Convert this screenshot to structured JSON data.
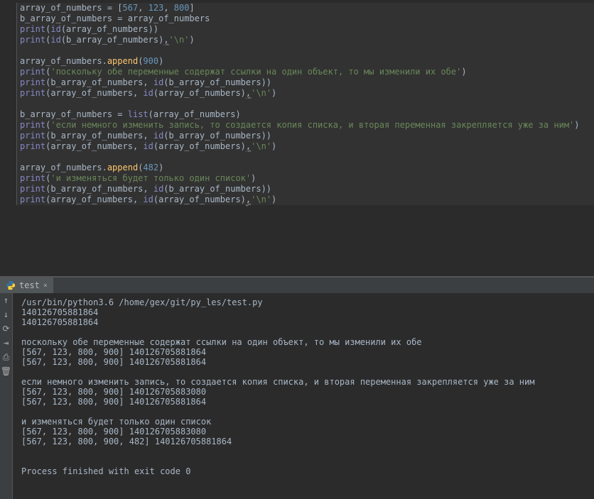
{
  "editor": {
    "lines": [
      {
        "tokens": [
          {
            "t": "array_of_numbers ",
            "c": "k-var"
          },
          {
            "t": "=",
            "c": "punc"
          },
          {
            "t": " [",
            "c": "punc"
          },
          {
            "t": "567",
            "c": "k-num"
          },
          {
            "t": ", ",
            "c": "punc"
          },
          {
            "t": "123",
            "c": "k-num"
          },
          {
            "t": ", ",
            "c": "punc"
          },
          {
            "t": "800",
            "c": "k-num"
          },
          {
            "t": "]",
            "c": "punc"
          }
        ]
      },
      {
        "tokens": [
          {
            "t": "b_array_of_numbers ",
            "c": "k-var"
          },
          {
            "t": "=",
            "c": "punc"
          },
          {
            "t": " array_of_numbers",
            "c": "k-var"
          }
        ]
      },
      {
        "tokens": [
          {
            "t": "print",
            "c": "k-builtin"
          },
          {
            "t": "(",
            "c": "punc"
          },
          {
            "t": "id",
            "c": "k-builtin"
          },
          {
            "t": "(array_of_numbers))",
            "c": "k-var"
          }
        ]
      },
      {
        "tokens": [
          {
            "t": "print",
            "c": "k-builtin"
          },
          {
            "t": "(",
            "c": "punc"
          },
          {
            "t": "id",
            "c": "k-builtin"
          },
          {
            "t": "(b_array_of_numbers)",
            "c": "k-var"
          },
          {
            "t": ",",
            "c": "comma-mark"
          },
          {
            "t": "'\\n'",
            "c": "k-str"
          },
          {
            "t": ")",
            "c": "punc"
          }
        ]
      },
      {
        "tokens": []
      },
      {
        "tokens": [
          {
            "t": "array_of_numbers.",
            "c": "k-var"
          },
          {
            "t": "append",
            "c": "k-func"
          },
          {
            "t": "(",
            "c": "punc"
          },
          {
            "t": "900",
            "c": "k-num"
          },
          {
            "t": ")",
            "c": "punc"
          }
        ]
      },
      {
        "tokens": [
          {
            "t": "print",
            "c": "k-builtin"
          },
          {
            "t": "(",
            "c": "punc"
          },
          {
            "t": "'поскольку обе переменные содержат ссылки на один объект, то мы изменили их обе'",
            "c": "k-str"
          },
          {
            "t": ")",
            "c": "punc"
          }
        ]
      },
      {
        "tokens": [
          {
            "t": "print",
            "c": "k-builtin"
          },
          {
            "t": "(b_array_of_numbers, ",
            "c": "k-var"
          },
          {
            "t": "id",
            "c": "k-builtin"
          },
          {
            "t": "(b_array_of_numbers))",
            "c": "k-var"
          }
        ]
      },
      {
        "tokens": [
          {
            "t": "print",
            "c": "k-builtin"
          },
          {
            "t": "(array_of_numbers, ",
            "c": "k-var"
          },
          {
            "t": "id",
            "c": "k-builtin"
          },
          {
            "t": "(array_of_numbers)",
            "c": "k-var"
          },
          {
            "t": ",",
            "c": "comma-mark"
          },
          {
            "t": "'\\n'",
            "c": "k-str"
          },
          {
            "t": ")",
            "c": "punc"
          }
        ]
      },
      {
        "tokens": []
      },
      {
        "tokens": [
          {
            "t": "b_array_of_numbers ",
            "c": "k-var"
          },
          {
            "t": "=",
            "c": "punc"
          },
          {
            "t": " ",
            "c": "punc"
          },
          {
            "t": "list",
            "c": "k-builtin"
          },
          {
            "t": "(array_of_numbers)",
            "c": "k-var"
          }
        ]
      },
      {
        "tokens": [
          {
            "t": "print",
            "c": "k-builtin"
          },
          {
            "t": "(",
            "c": "punc"
          },
          {
            "t": "'если немного изменить запись, то создается копия списка, и вторая переменная закрепляется уже за ним'",
            "c": "k-str"
          },
          {
            "t": ")",
            "c": "punc"
          }
        ]
      },
      {
        "tokens": [
          {
            "t": "print",
            "c": "k-builtin"
          },
          {
            "t": "(b_array_of_numbers, ",
            "c": "k-var"
          },
          {
            "t": "id",
            "c": "k-builtin"
          },
          {
            "t": "(b_array_of_numbers))",
            "c": "k-var"
          }
        ]
      },
      {
        "tokens": [
          {
            "t": "print",
            "c": "k-builtin"
          },
          {
            "t": "(array_of_numbers, ",
            "c": "k-var"
          },
          {
            "t": "id",
            "c": "k-builtin"
          },
          {
            "t": "(array_of_numbers)",
            "c": "k-var"
          },
          {
            "t": ",",
            "c": "comma-mark"
          },
          {
            "t": "'\\n'",
            "c": "k-str"
          },
          {
            "t": ")",
            "c": "punc"
          }
        ]
      },
      {
        "tokens": []
      },
      {
        "tokens": [
          {
            "t": "array_of_numbers.",
            "c": "k-var"
          },
          {
            "t": "append",
            "c": "k-func"
          },
          {
            "t": "(",
            "c": "punc"
          },
          {
            "t": "482",
            "c": "k-num"
          },
          {
            "t": ")",
            "c": "punc"
          }
        ]
      },
      {
        "tokens": [
          {
            "t": "print",
            "c": "k-builtin"
          },
          {
            "t": "(",
            "c": "punc"
          },
          {
            "t": "'и изменяться будет только один список'",
            "c": "k-str"
          },
          {
            "t": ")",
            "c": "punc"
          }
        ]
      },
      {
        "tokens": [
          {
            "t": "print",
            "c": "k-builtin"
          },
          {
            "t": "(b_array_of_numbers, ",
            "c": "k-var"
          },
          {
            "t": "id",
            "c": "k-builtin"
          },
          {
            "t": "(b_array_of_numbers))",
            "c": "k-var"
          }
        ]
      },
      {
        "tokens": [
          {
            "t": "print",
            "c": "k-builtin"
          },
          {
            "t": "(array_of_numbers, ",
            "c": "k-var"
          },
          {
            "t": "id",
            "c": "k-builtin"
          },
          {
            "t": "(array_of_numbers)",
            "c": "k-var"
          },
          {
            "t": ",",
            "c": "comma-mark"
          },
          {
            "t": "'\\n'",
            "c": "k-str"
          },
          {
            "t": ")",
            "c": "punc"
          }
        ]
      }
    ]
  },
  "tab": {
    "label": "test",
    "close": "×"
  },
  "console": {
    "lines": [
      "/usr/bin/python3.6 /home/gex/git/py_les/test.py",
      "140126705881864",
      "140126705881864",
      "",
      "поскольку обе переменные содержат ссылки на один объект, то мы изменили их обе",
      "[567, 123, 800, 900] 140126705881864",
      "[567, 123, 800, 900] 140126705881864",
      "",
      "если немного изменить запись, то создается копия списка, и вторая переменная закрепляется уже за ним",
      "[567, 123, 800, 900] 140126705883080",
      "[567, 123, 800, 900] 140126705881864",
      "",
      "и изменяться будет только один список",
      "[567, 123, 800, 900] 140126705883080",
      "[567, 123, 800, 900, 482] 140126705881864",
      "",
      "",
      "Process finished with exit code 0"
    ]
  },
  "tools": [
    "↑",
    "↓",
    "⟳",
    "⇥",
    "⎙",
    "🗑"
  ]
}
